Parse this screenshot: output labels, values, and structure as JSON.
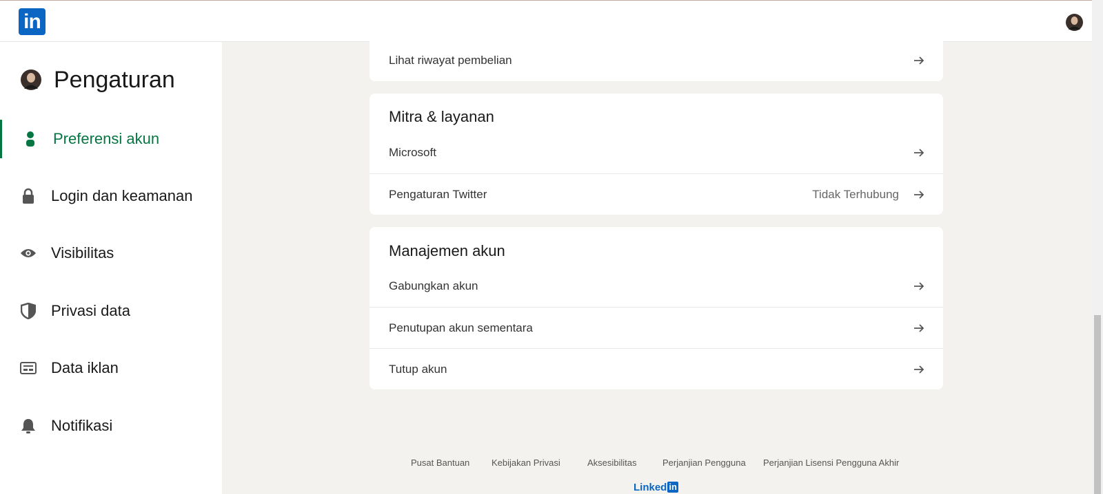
{
  "header": {
    "logo_text": "in"
  },
  "sidebar": {
    "title": "Pengaturan",
    "items": [
      {
        "label": "Preferensi akun",
        "icon": "person-icon",
        "active": true
      },
      {
        "label": "Login dan keamanan",
        "icon": "lock-icon",
        "active": false
      },
      {
        "label": "Visibilitas",
        "icon": "eye-icon",
        "active": false
      },
      {
        "label": "Privasi data",
        "icon": "shield-icon",
        "active": false
      },
      {
        "label": "Data iklan",
        "icon": "ad-card-icon",
        "active": false
      },
      {
        "label": "Notifikasi",
        "icon": "bell-icon",
        "active": false
      }
    ]
  },
  "main": {
    "purchase_row": {
      "label": "Lihat riwayat pembelian"
    },
    "partners": {
      "title": "Mitra & layanan",
      "rows": [
        {
          "label": "Microsoft",
          "value": ""
        },
        {
          "label": "Pengaturan Twitter",
          "value": "Tidak Terhubung"
        }
      ]
    },
    "account_mgmt": {
      "title": "Manajemen akun",
      "rows": [
        {
          "label": "Gabungkan akun"
        },
        {
          "label": "Penutupan akun sementara"
        },
        {
          "label": "Tutup akun"
        }
      ]
    }
  },
  "footer": {
    "links": [
      "Pusat Bantuan",
      "Kebijakan Privasi",
      "Aksesibilitas",
      "Perjanjian Pengguna",
      "Perjanjian Lisensi Pengguna Akhir"
    ],
    "logo_word": "Linked",
    "logo_in": "in"
  },
  "colors": {
    "accent_green": "#057642",
    "brand_blue": "#0a66c2",
    "page_bg": "#f4f2ee"
  }
}
